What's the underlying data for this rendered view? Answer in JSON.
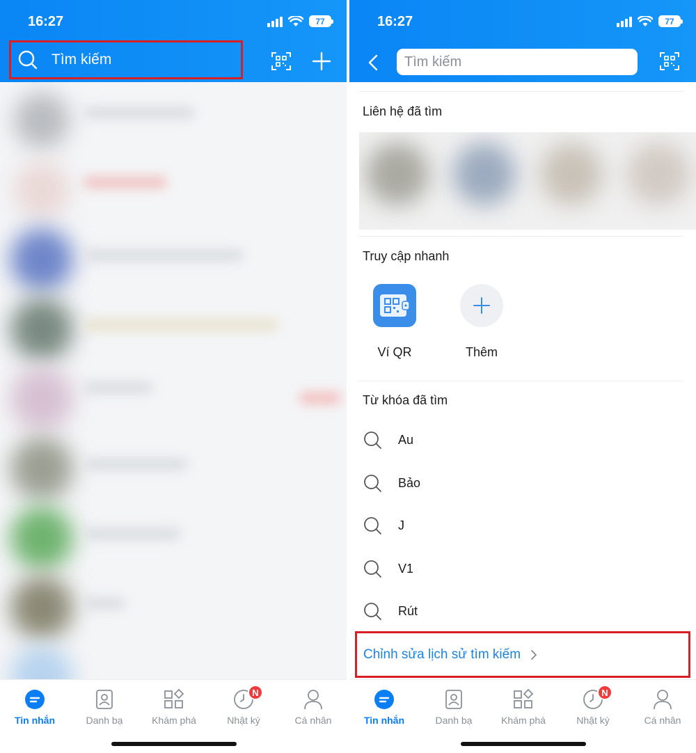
{
  "status": {
    "time": "16:27",
    "battery": "77"
  },
  "left_screen": {
    "search_label": "Tìm kiếm",
    "icons": {
      "search": "search-icon",
      "qr_scan": "qr-scan-icon",
      "add": "plus-icon"
    }
  },
  "right_screen": {
    "search_placeholder": "Tìm kiếm",
    "icons": {
      "back": "back-arrow-icon",
      "qr_scan": "qr-scan-icon"
    },
    "sections": {
      "recent_contacts": "Liên hệ đã tìm",
      "quick_access": "Truy cập nhanh",
      "recent_keywords": "Từ khóa đã tìm"
    },
    "quick_access": [
      {
        "label": "Ví QR",
        "icon": "qr-wallet-icon"
      },
      {
        "label": "Thêm",
        "icon": "plus-icon"
      }
    ],
    "keywords": [
      "Au",
      "Bảo",
      "J",
      "V1",
      "Rút"
    ],
    "edit_history": "Chỉnh sửa lịch sử tìm kiếm"
  },
  "tabbar": {
    "tabs": [
      {
        "label": "Tin nhắn",
        "icon": "chat-icon",
        "active": true
      },
      {
        "label": "Danh bạ",
        "icon": "contacts-icon",
        "active": false
      },
      {
        "label": "Khám phá",
        "icon": "discover-icon",
        "active": false
      },
      {
        "label": "Nhật ký",
        "icon": "clock-icon",
        "active": false,
        "badge": "N"
      },
      {
        "label": "Cá nhân",
        "icon": "person-icon",
        "active": false
      }
    ]
  },
  "colors": {
    "header": "#0a86f5",
    "accent": "#0a7ef2",
    "highlight": "#d81f26",
    "badge": "#ef3b3b"
  }
}
